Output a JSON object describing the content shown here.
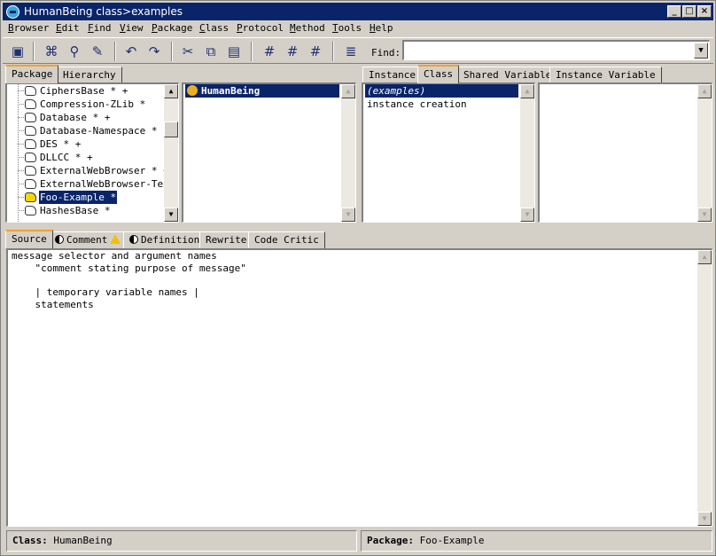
{
  "window": {
    "title": "HumanBeing class>examples"
  },
  "title_buttons": {
    "minimize": "_",
    "maximize": "□",
    "close": "×"
  },
  "menu": [
    "Browser",
    "Edit",
    "Find",
    "View",
    "Package",
    "Class",
    "Protocol",
    "Method",
    "Tools",
    "Help"
  ],
  "toolbar": {
    "icons": [
      "browser-icon",
      "binoculars-icon",
      "find-class-icon",
      "find-method-icon",
      "undo-icon",
      "redo-icon",
      "cut-icon",
      "copy-icon",
      "paste-icon",
      "search-senders-icon",
      "search-implementors-icon",
      "search-references-icon",
      "format-icon"
    ],
    "find_label": "Find:",
    "find_value": ""
  },
  "package_tabs": [
    "Package",
    "Hierarchy"
  ],
  "packages": [
    {
      "label": "CiphersBase * +",
      "selected": false,
      "warn": false
    },
    {
      "label": "Compression-ZLib *",
      "selected": false,
      "warn": false
    },
    {
      "label": "Database * +",
      "selected": false,
      "warn": false
    },
    {
      "label": "Database-Namespace *",
      "selected": false,
      "warn": false
    },
    {
      "label": "DES * +",
      "selected": false,
      "warn": false
    },
    {
      "label": "DLLCC * +",
      "selected": false,
      "warn": false
    },
    {
      "label": "ExternalWebBrowser * +",
      "selected": false,
      "warn": false
    },
    {
      "label": "ExternalWebBrowser-Text",
      "selected": false,
      "warn": false
    },
    {
      "label": "Foo-Example *",
      "selected": true,
      "warn": true
    },
    {
      "label": "HashesBase *",
      "selected": false,
      "warn": false
    }
  ],
  "classes": [
    {
      "label": "HumanBeing",
      "selected": true
    }
  ],
  "side_tabs": [
    "Instance",
    "Class",
    "Shared Variable",
    "Instance Variable"
  ],
  "active_side_tab": "Class",
  "protocols": [
    {
      "label": "(examples)",
      "selected": true
    },
    {
      "label": "instance creation",
      "selected": false
    }
  ],
  "editor_tabs": [
    "Source",
    "Comment",
    "Definition",
    "Rewrite",
    "Code Critic"
  ],
  "source": [
    "message selector and argument names",
    "    \"comment stating purpose of message\"",
    "",
    "    | temporary variable names |",
    "    statements"
  ],
  "status": {
    "class_label": "Class:",
    "class_value": "HumanBeing",
    "package_label": "Package:",
    "package_value": "Foo-Example"
  }
}
